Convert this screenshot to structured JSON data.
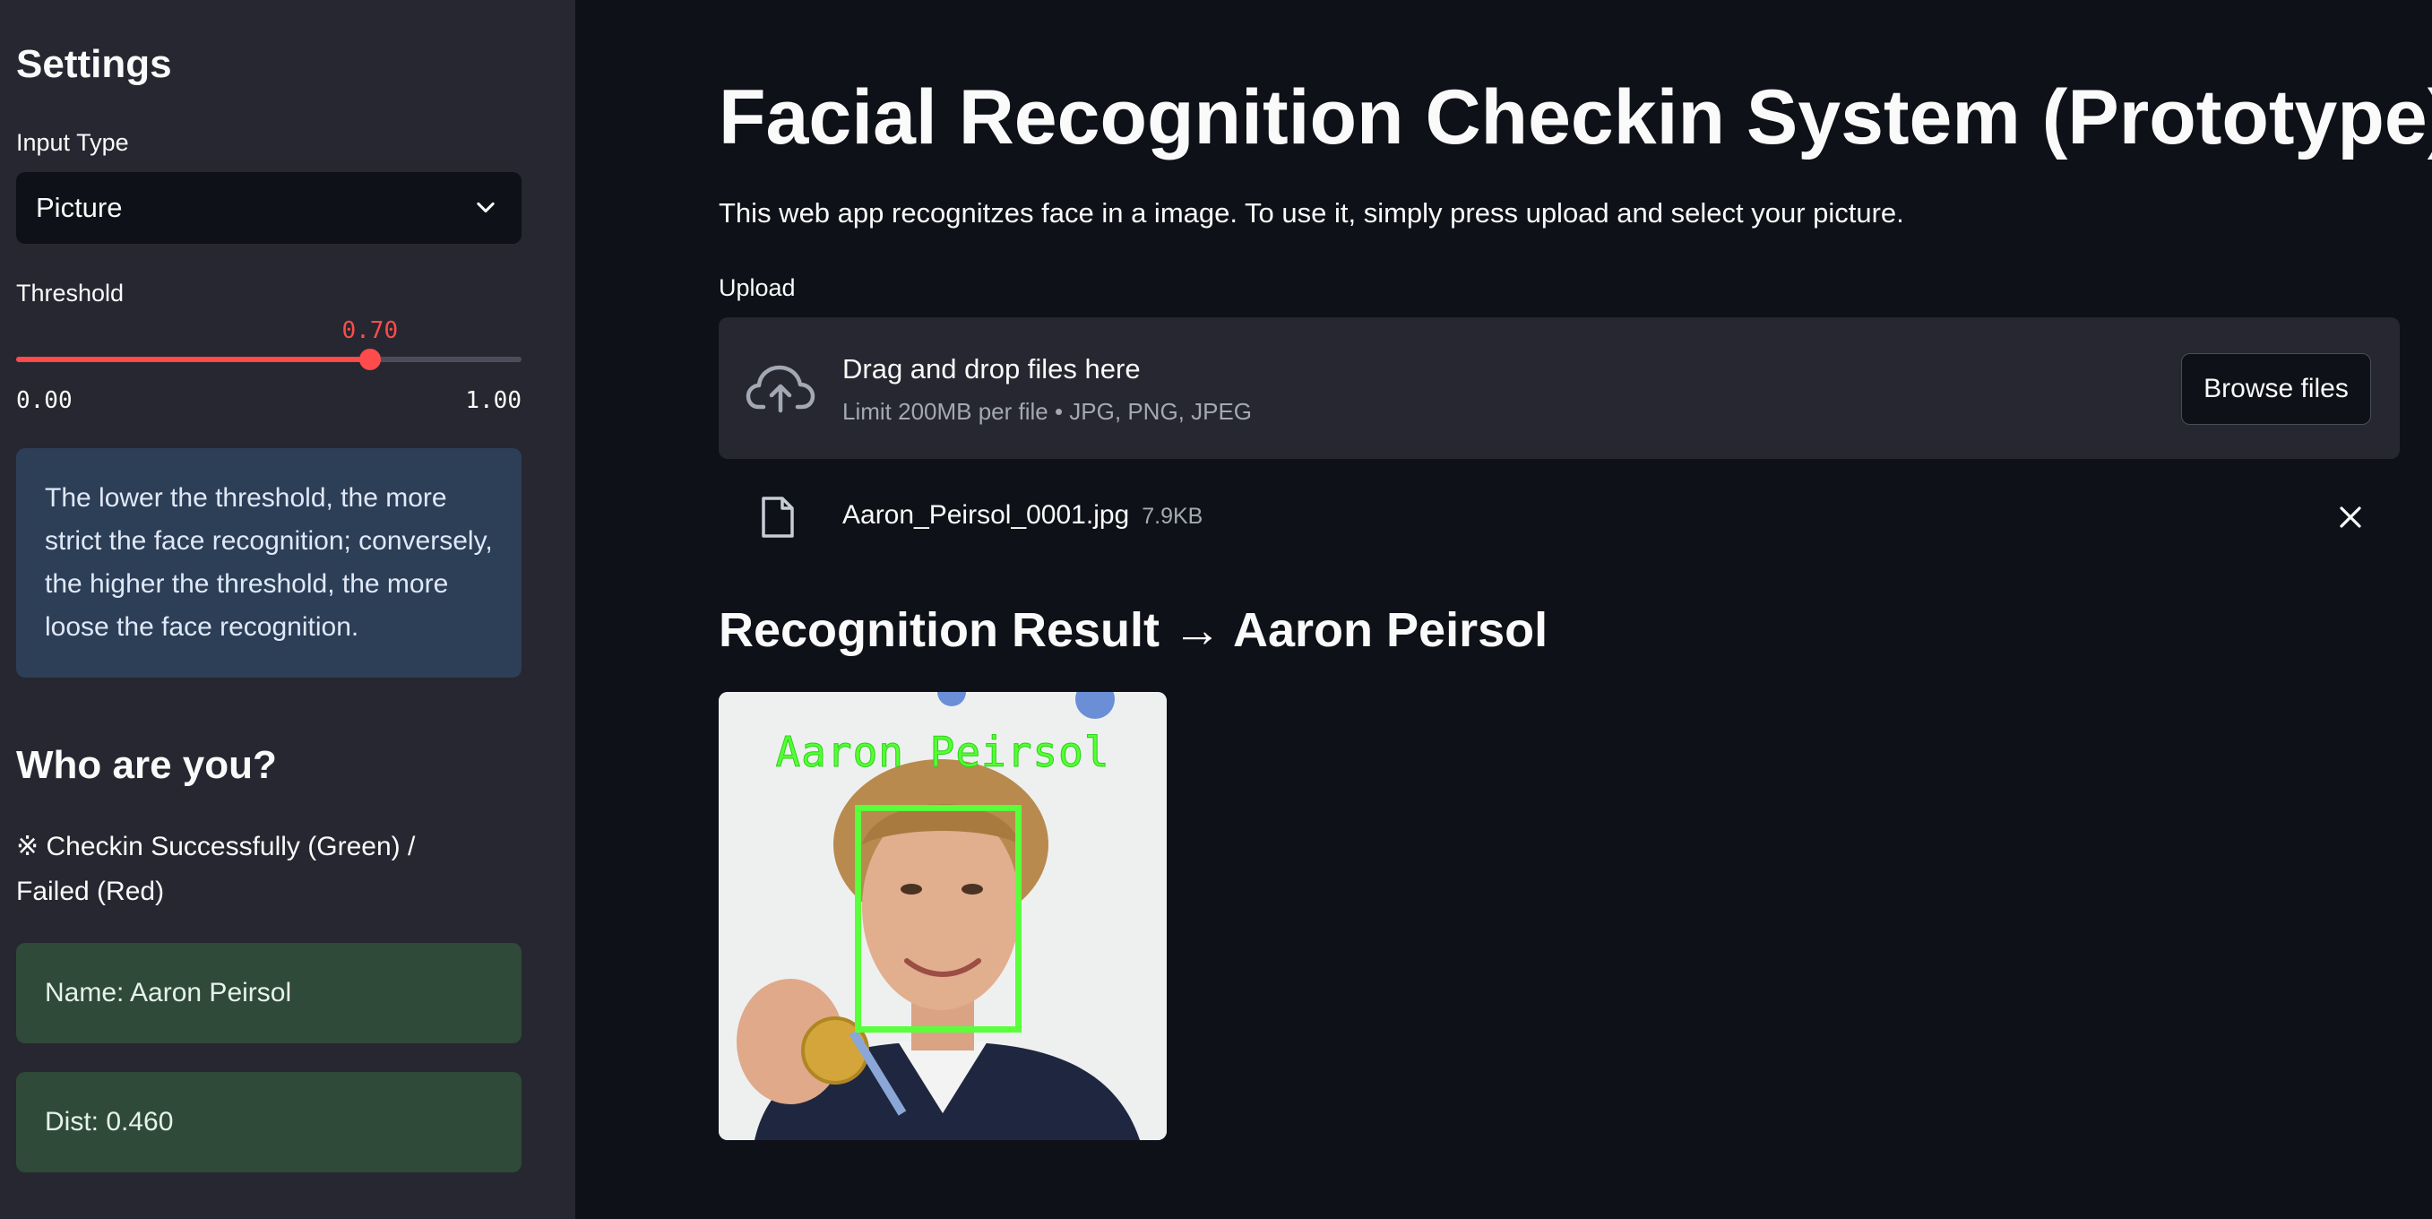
{
  "sidebar": {
    "settings_title": "Settings",
    "input_type_label": "Input Type",
    "input_type_value": "Picture",
    "threshold_label": "Threshold",
    "threshold_value": "0.70",
    "threshold_level": 0.7,
    "threshold_min": "0.00",
    "threshold_max": "1.00",
    "info_text": "The lower the threshold, the more strict the face recognition; conversely, the higher the threshold, the more loose the face recognition.",
    "who_title": "Who are you?",
    "checkin_note": "※ Checkin Successfully (Green) / Failed (Red)",
    "name_result": "Name: Aaron Peirsol",
    "dist_result": "Dist: 0.460"
  },
  "main": {
    "title": "Facial Recognition Checkin System (Prototype)",
    "description": "This web app recognitzes face in a image. To use it, simply press upload and select your picture.",
    "upload_label": "Upload",
    "dropzone_title": "Drag and drop files here",
    "dropzone_limit": "Limit 200MB per file • JPG, PNG, JPEG",
    "browse_label": "Browse files",
    "file_name": "Aaron_Peirsol_0001.jpg",
    "file_size": "7.9KB",
    "result_heading": "Recognition Result → Aaron Peirsol",
    "overlay_name": "Aaron Peirsol"
  },
  "colors": {
    "accent": "#ff4b4b",
    "sidebar_bg": "#262730",
    "main_bg": "#0e1117",
    "info_bg": "#2d3e57",
    "success_bg": "#2f4a38",
    "face_box": "#5aff3c"
  },
  "icons": {
    "dropdown": "chevron-down-icon",
    "upload": "cloud-upload-icon",
    "file": "file-icon",
    "remove": "close-icon"
  }
}
